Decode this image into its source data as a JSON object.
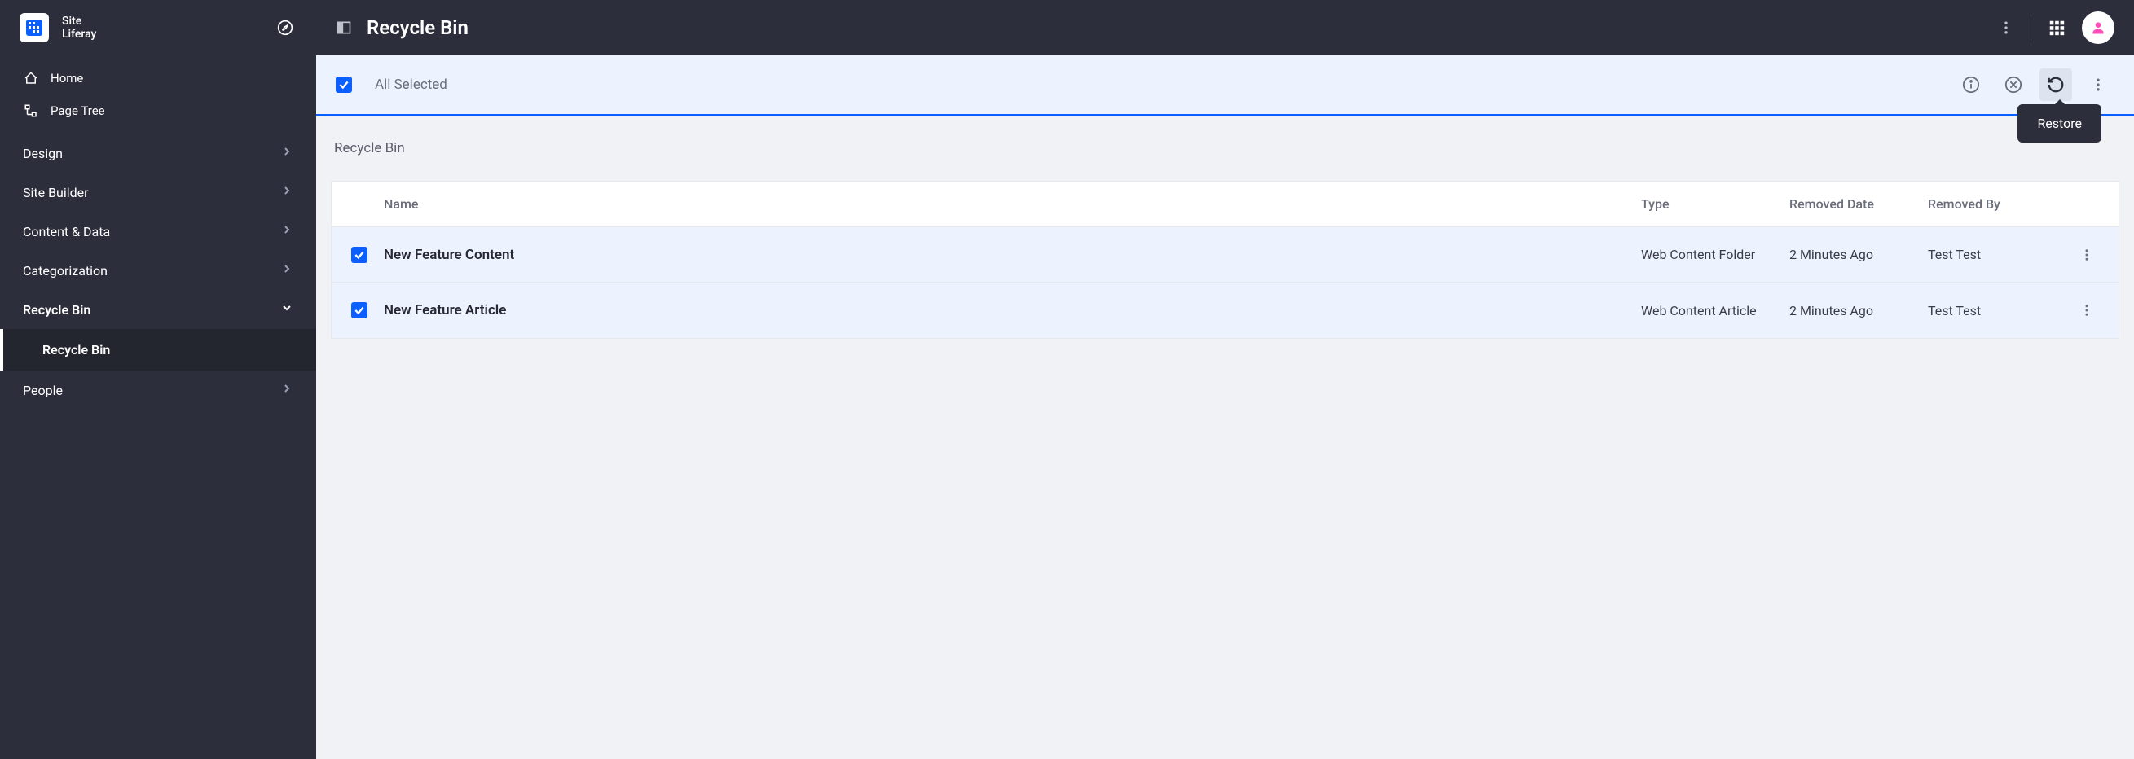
{
  "site": {
    "label": "Site",
    "name": "Liferay"
  },
  "sidebar": {
    "topItems": [
      {
        "label": "Home"
      },
      {
        "label": "Page Tree"
      }
    ],
    "groups": [
      {
        "label": "Design"
      },
      {
        "label": "Site Builder"
      },
      {
        "label": "Content & Data"
      },
      {
        "label": "Categorization"
      },
      {
        "label": "Recycle Bin",
        "active": true,
        "sub": "Recycle Bin"
      },
      {
        "label": "People"
      }
    ]
  },
  "header": {
    "title": "Recycle Bin"
  },
  "toolbar": {
    "label": "All Selected",
    "tooltip": "Restore"
  },
  "breadcrumb": "Recycle Bin",
  "table": {
    "headers": {
      "name": "Name",
      "type": "Type",
      "date": "Removed Date",
      "by": "Removed By"
    },
    "rows": [
      {
        "name": "New Feature Content",
        "type": "Web Content Folder",
        "date": "2 Minutes Ago",
        "by": "Test Test"
      },
      {
        "name": "New Feature Article",
        "type": "Web Content Article",
        "date": "2 Minutes Ago",
        "by": "Test Test"
      }
    ]
  }
}
